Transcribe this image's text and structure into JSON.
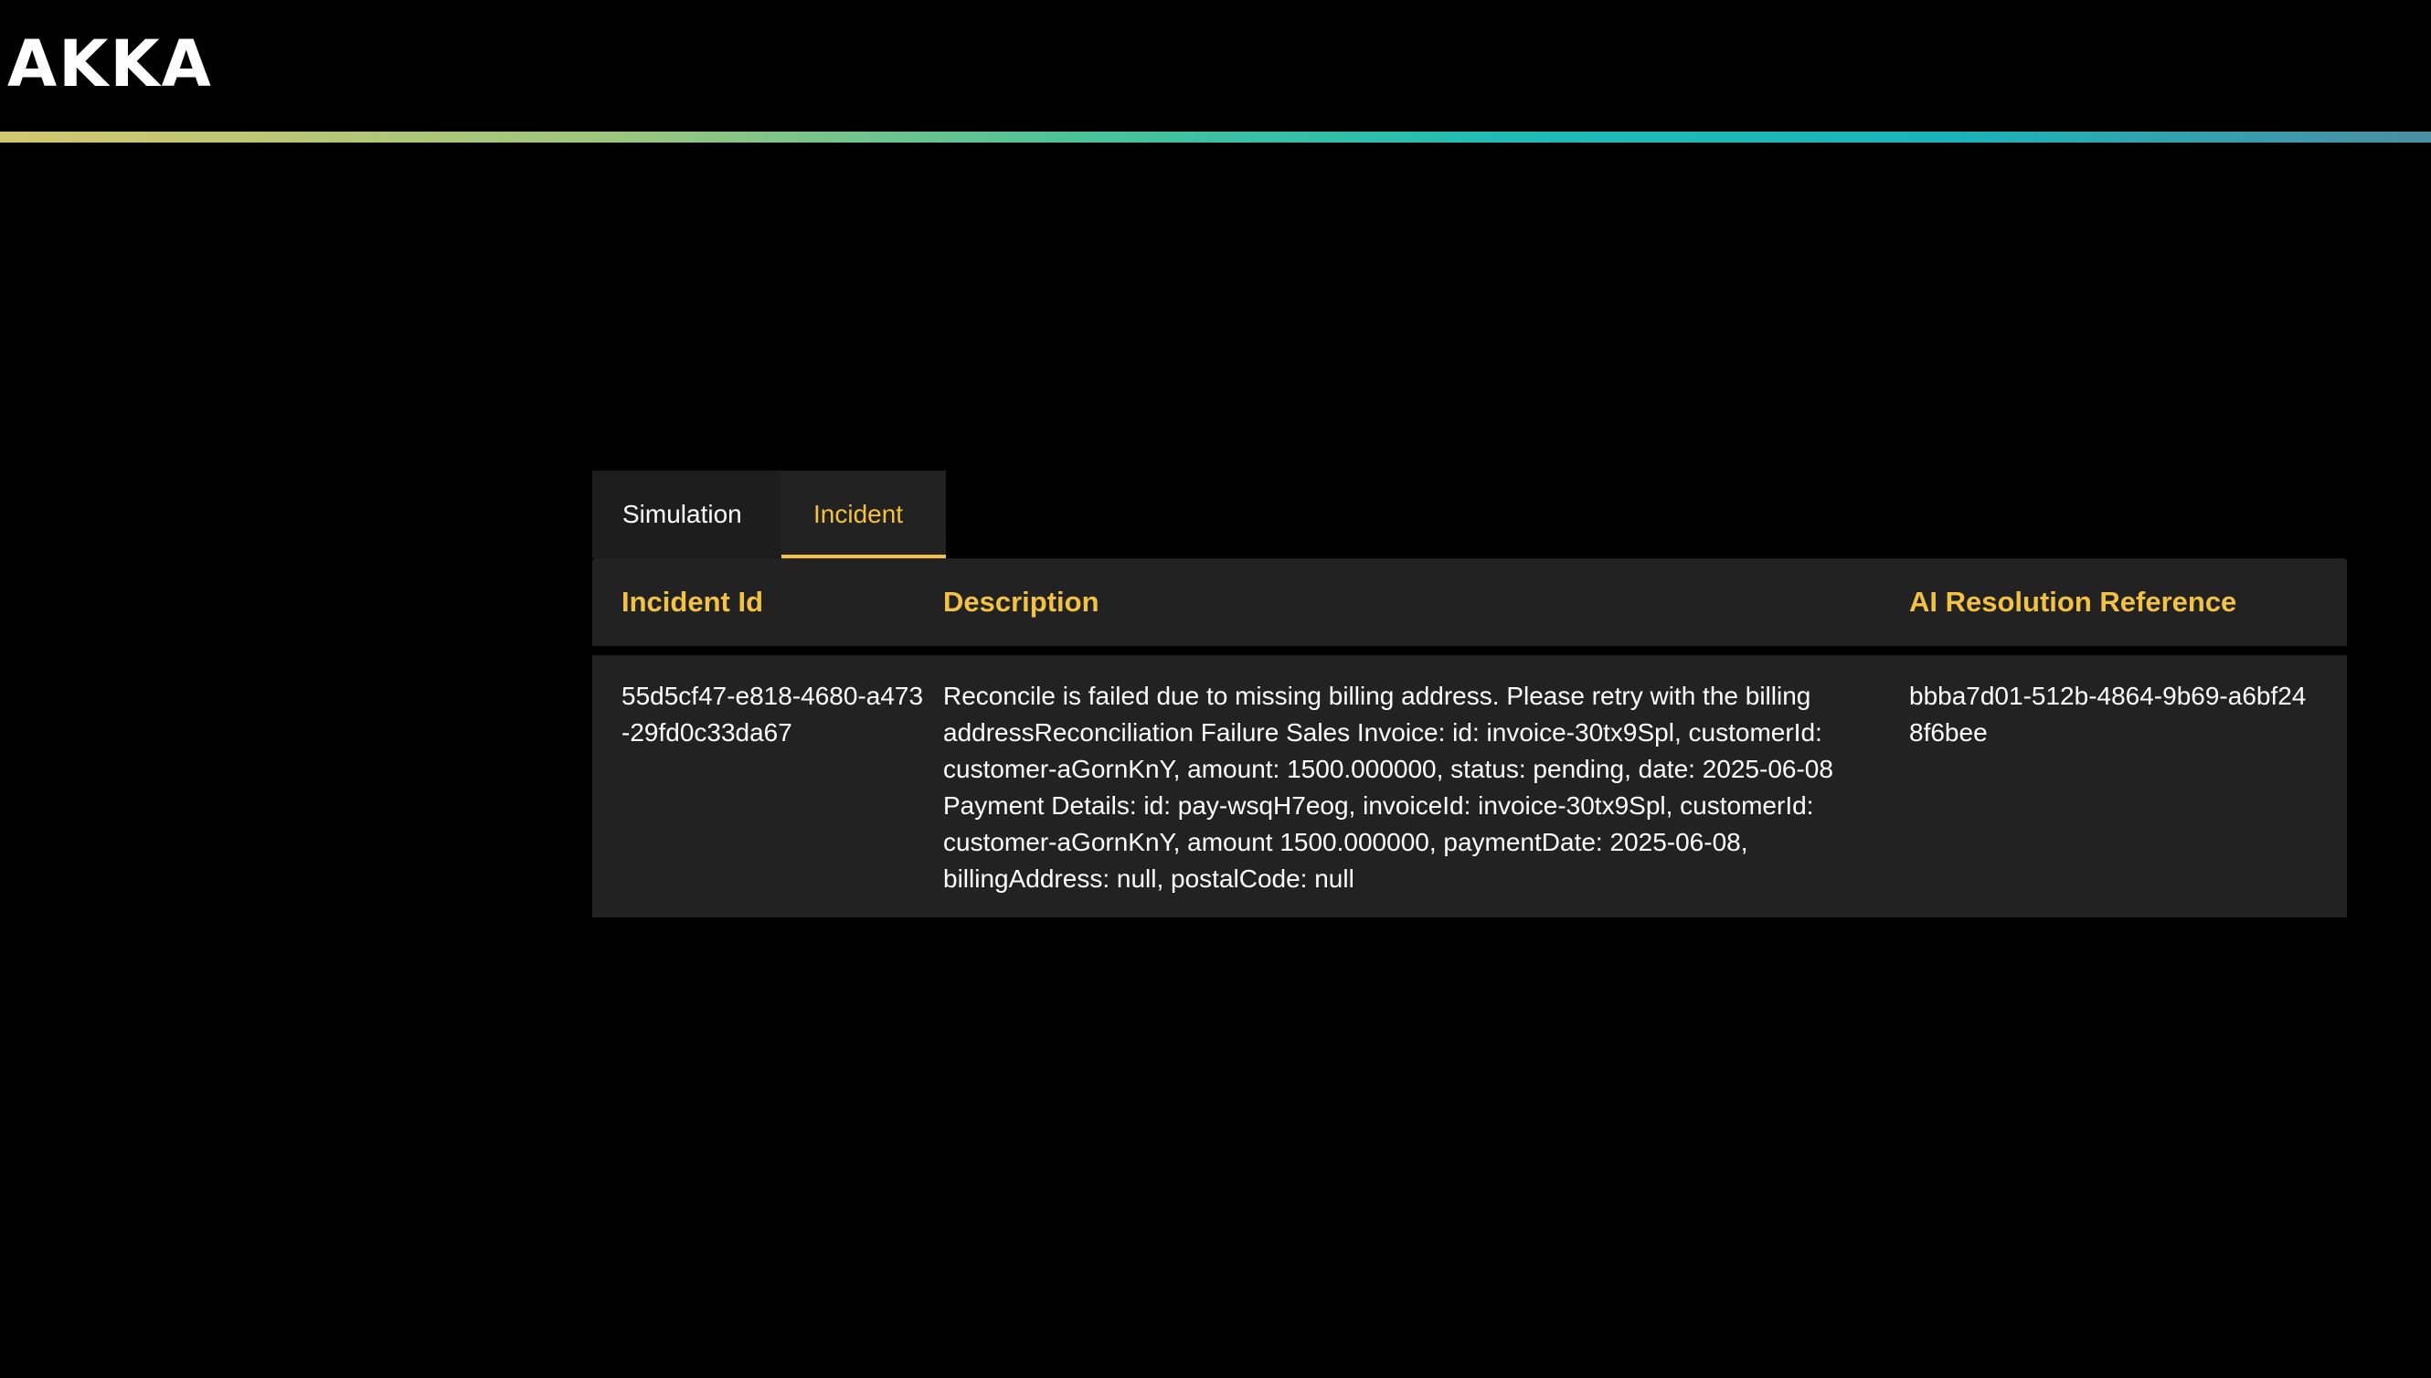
{
  "header": {
    "logo_text": "AKKA"
  },
  "tabs": [
    {
      "label": "Simulation",
      "active": false
    },
    {
      "label": "Incident",
      "active": true
    }
  ],
  "table": {
    "columns": [
      "Incident Id",
      "Description",
      "AI Resolution Reference"
    ],
    "rows": [
      {
        "incident_id": "55d5cf47-e818-4680-a473-29fd0c33da67",
        "description": "Reconcile is failed due to missing billing address. Please retry with the billing addressReconciliation Failure Sales Invoice: id: invoice-30tx9Spl, customerId: customer-aGornKnY, amount: 1500.000000, status: pending, date: 2025-06-08 Payment Details: id: pay-wsqH7eog, invoiceId: invoice-30tx9Spl, customerId: customer-aGornKnY, amount 1500.000000, paymentDate: 2025-06-08, billingAddress: null, postalCode: null",
        "ai_resolution_reference": "bbba7d01-512b-4864-9b69-a6bf248f6bee"
      }
    ]
  },
  "colors": {
    "background": "#000000",
    "accent": "#f3c244",
    "panel": "#222222"
  }
}
